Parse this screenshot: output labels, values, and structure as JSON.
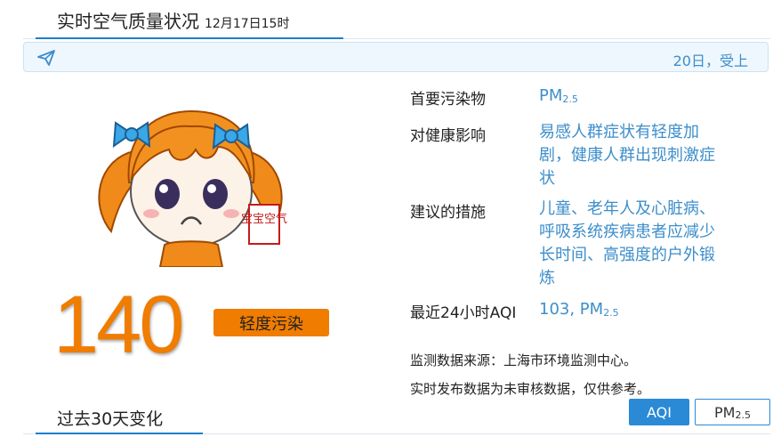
{
  "header": {
    "title": "实时空气质量状况",
    "datetime": "12月17日15时"
  },
  "notice": {
    "icon": "paper-plane-icon",
    "text": "20日，受上"
  },
  "aqi": {
    "value": "140",
    "level": "轻度污染"
  },
  "info": {
    "primary_pollutant": {
      "label": "首要污染物",
      "value": "PM",
      "sub": "2.5"
    },
    "health_impact": {
      "label": "对健康影响",
      "value": "易感人群症状有轻度加剧，健康人群出现刺激症状"
    },
    "advice": {
      "label": "建议的措施",
      "value": "儿童、老年人及心脏病、呼吸系统疾病患者应减少长时间、高强度的户外锻炼"
    },
    "last24": {
      "label": "最近24小时AQI",
      "value": "103, PM",
      "sub": "2.5"
    }
  },
  "source": "监测数据来源：上海市环境监测中心。",
  "disclaimer": "实时发布数据为未审核数据，仅供参考。",
  "past": {
    "title": "过去30天变化"
  },
  "buttons": {
    "aqi": "AQI",
    "pm": "PM",
    "pm_sub": "2.5"
  },
  "mascot": {
    "seal_text": "宝宝空气"
  },
  "colors": {
    "accent": "#1e7fc8",
    "link": "#3d8ecb",
    "orange": "#f07c00"
  }
}
